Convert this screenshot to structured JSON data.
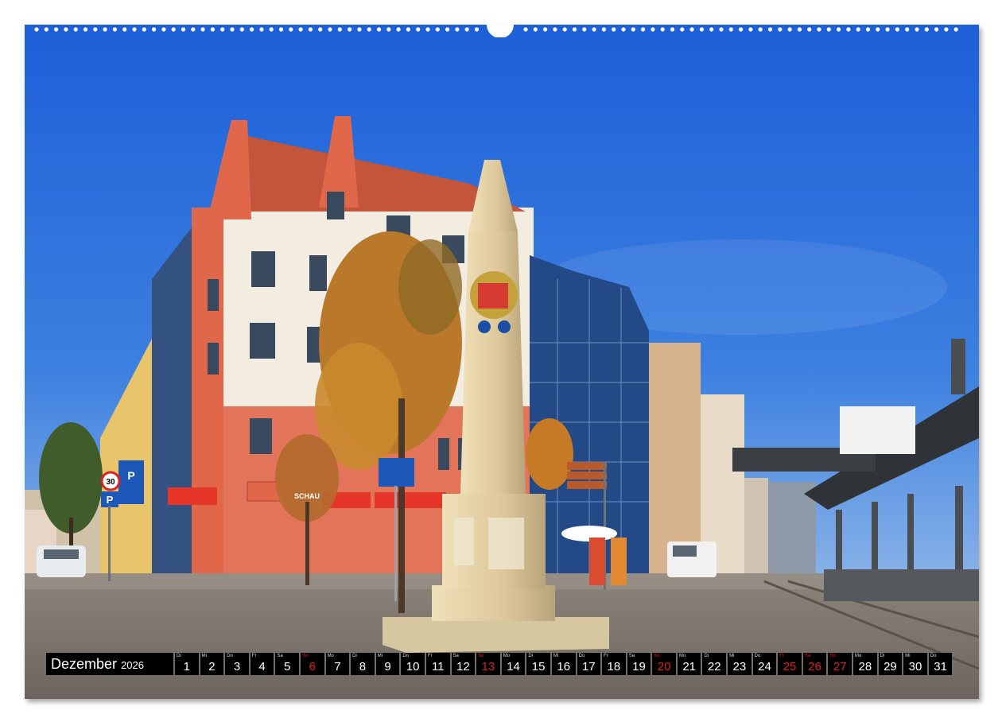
{
  "calendar": {
    "month": "Dezember",
    "year": "2026",
    "weekend_color": "#e0201c",
    "days": [
      {
        "abbr": "Di",
        "num": "1",
        "weekend": false
      },
      {
        "abbr": "Mi",
        "num": "2",
        "weekend": false
      },
      {
        "abbr": "Do",
        "num": "3",
        "weekend": false
      },
      {
        "abbr": "Fr",
        "num": "4",
        "weekend": false
      },
      {
        "abbr": "Sa",
        "num": "5",
        "weekend": false
      },
      {
        "abbr": "So",
        "num": "6",
        "weekend": true
      },
      {
        "abbr": "Mo",
        "num": "7",
        "weekend": false
      },
      {
        "abbr": "Di",
        "num": "8",
        "weekend": false
      },
      {
        "abbr": "Mi",
        "num": "9",
        "weekend": false
      },
      {
        "abbr": "Do",
        "num": "10",
        "weekend": false
      },
      {
        "abbr": "Fr",
        "num": "11",
        "weekend": false
      },
      {
        "abbr": "Sa",
        "num": "12",
        "weekend": false
      },
      {
        "abbr": "So",
        "num": "13",
        "weekend": true
      },
      {
        "abbr": "Mo",
        "num": "14",
        "weekend": false
      },
      {
        "abbr": "Di",
        "num": "15",
        "weekend": false
      },
      {
        "abbr": "Mi",
        "num": "16",
        "weekend": false
      },
      {
        "abbr": "Do",
        "num": "17",
        "weekend": false
      },
      {
        "abbr": "Fr",
        "num": "18",
        "weekend": false
      },
      {
        "abbr": "Sa",
        "num": "19",
        "weekend": false
      },
      {
        "abbr": "So",
        "num": "20",
        "weekend": true
      },
      {
        "abbr": "Mo",
        "num": "21",
        "weekend": false
      },
      {
        "abbr": "Di",
        "num": "22",
        "weekend": false
      },
      {
        "abbr": "Mi",
        "num": "23",
        "weekend": false
      },
      {
        "abbr": "Do",
        "num": "24",
        "weekend": false
      },
      {
        "abbr": "Fr",
        "num": "25",
        "weekend": true
      },
      {
        "abbr": "Sa",
        "num": "26",
        "weekend": true
      },
      {
        "abbr": "So",
        "num": "27",
        "weekend": true
      },
      {
        "abbr": "Mo",
        "num": "28",
        "weekend": false
      },
      {
        "abbr": "Di",
        "num": "29",
        "weekend": false
      },
      {
        "abbr": "Mi",
        "num": "30",
        "weekend": false
      },
      {
        "abbr": "Do",
        "num": "31",
        "weekend": false
      }
    ]
  },
  "photo": {
    "sky_color": "#2f6fd6",
    "building_color": "#e0674a",
    "obelisk_color": "#e2cfa3",
    "sign_texts": [
      "30",
      "P",
      "P",
      "SCHAU"
    ]
  }
}
